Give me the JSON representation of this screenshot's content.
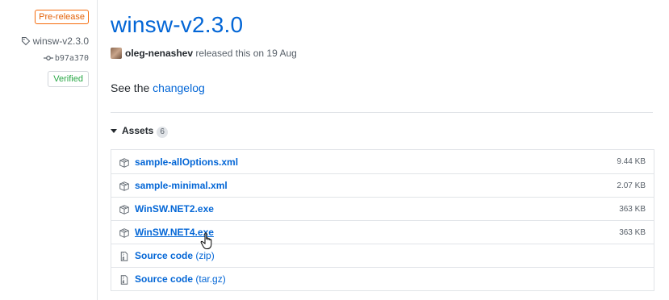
{
  "sidebar": {
    "prerelease_label": "Pre-release",
    "tag": "winsw-v2.3.0",
    "commit": "b97a370",
    "verified_label": "Verified"
  },
  "release": {
    "title": "winsw-v2.3.0",
    "author": "oleg-nenashev",
    "released_text": "released this on 19 Aug",
    "body_prefix": "See the",
    "body_link": "changelog"
  },
  "assets": {
    "header_label": "Assets",
    "count": "6",
    "items": [
      {
        "name": "sample-allOptions.xml",
        "suffix": "",
        "size": "9.44 KB",
        "icon": "package-icon"
      },
      {
        "name": "sample-minimal.xml",
        "suffix": "",
        "size": "2.07 KB",
        "icon": "package-icon"
      },
      {
        "name": "WinSW.NET2.exe",
        "suffix": "",
        "size": "363 KB",
        "icon": "package-icon"
      },
      {
        "name": "WinSW.NET4.exe",
        "suffix": "",
        "size": "363 KB",
        "icon": "package-icon"
      },
      {
        "name": "Source code",
        "suffix": "(zip)",
        "size": "",
        "icon": "file-zip-icon"
      },
      {
        "name": "Source code",
        "suffix": "(tar.gz)",
        "size": "",
        "icon": "file-zip-icon"
      }
    ]
  },
  "colors": {
    "link": "#0366d6",
    "prerelease": "#e36209",
    "verified": "#28a745"
  }
}
